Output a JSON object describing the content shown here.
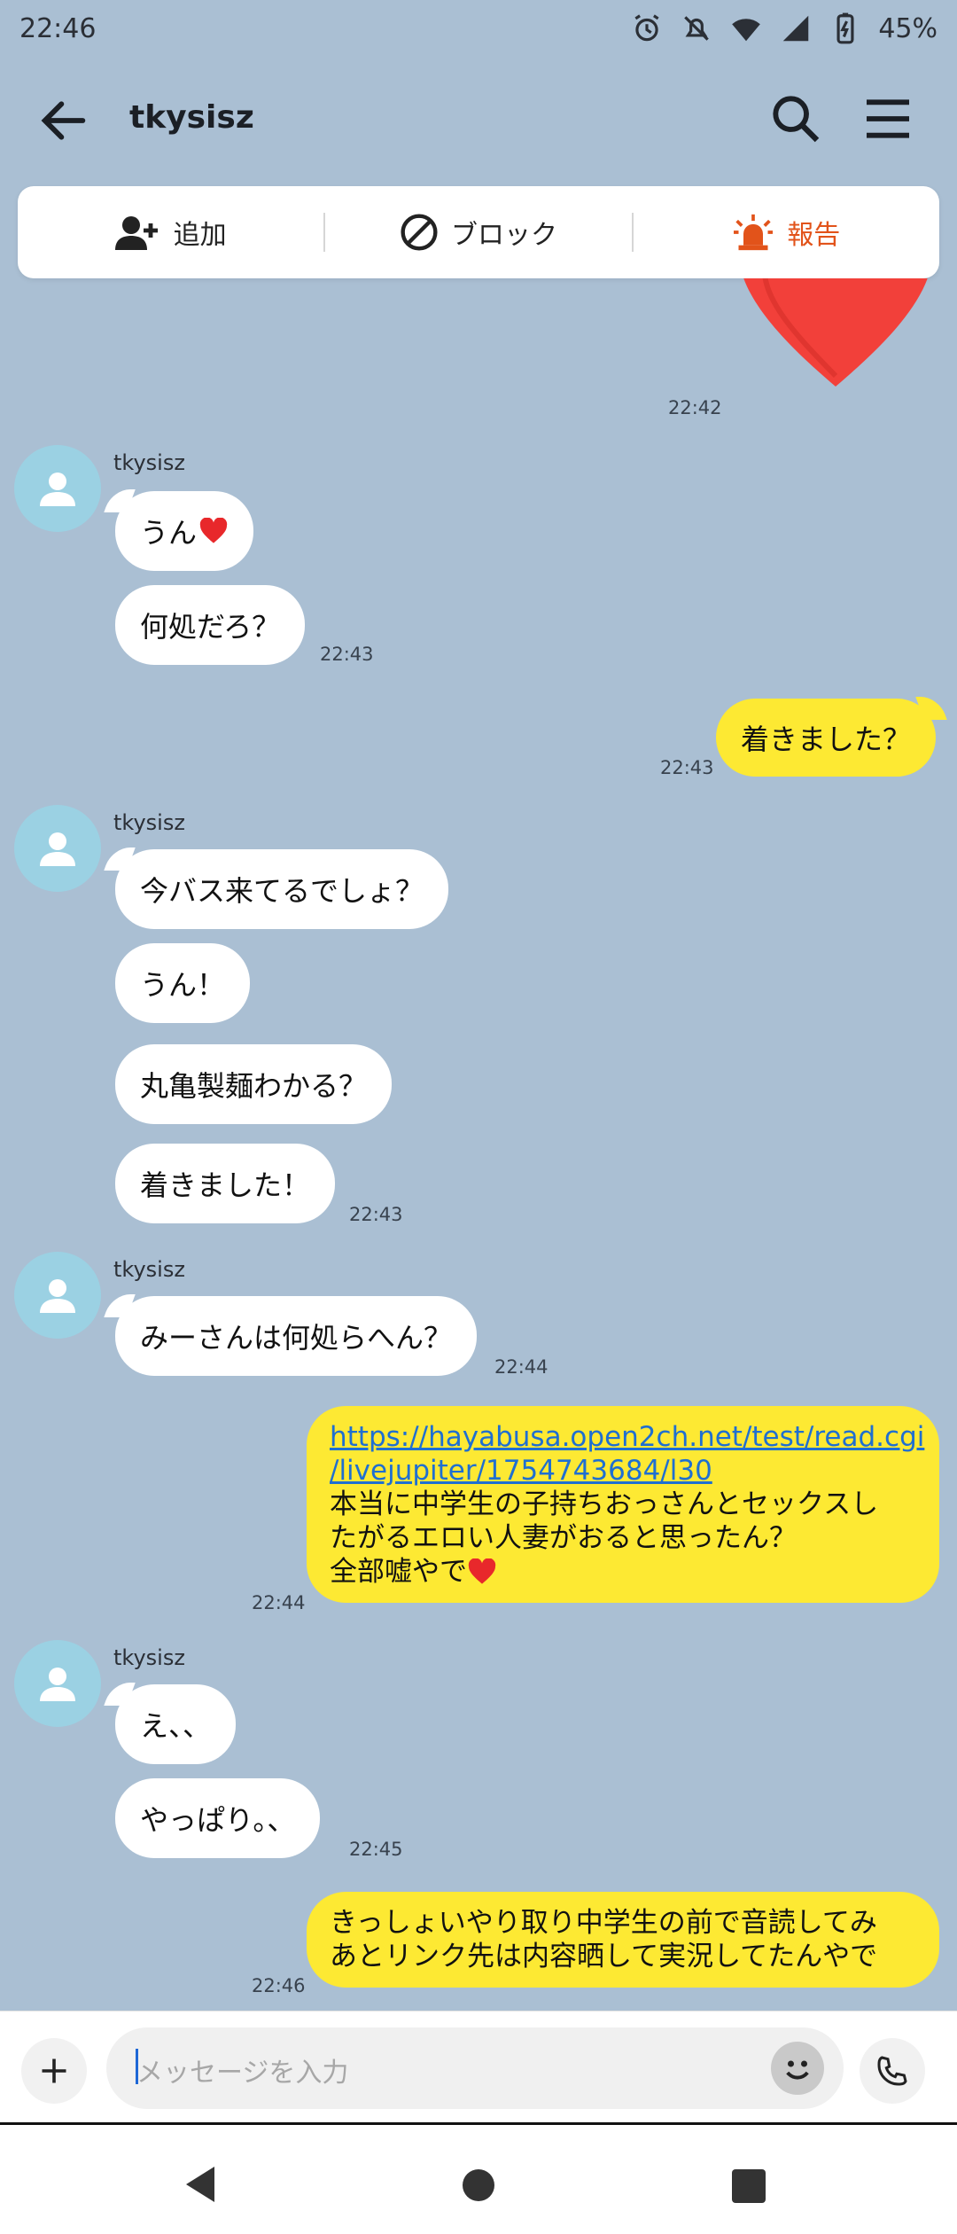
{
  "status": {
    "time": "22:46",
    "battery": "45%"
  },
  "header": {
    "title": "tkysisz"
  },
  "actions": {
    "add": "追加",
    "block": "ブロック",
    "report": "報告"
  },
  "chat": {
    "t0": "22:42",
    "s1_name": "tkysisz",
    "m1": "うん",
    "m2": "何処だろ？",
    "t1": "22:43",
    "my1": "着きました？",
    "t2": "22:43",
    "s2_name": "tkysisz",
    "m3": "今バス来てるでしょ？",
    "m4": "うん！",
    "m5": "丸亀製麺わかる？",
    "m6": "着きました！",
    "t3": "22:43",
    "s3_name": "tkysisz",
    "m7": "みーさんは何処らへん？",
    "t4": "22:44",
    "my2_link1": "https://hayabusa.open2ch.net/test/read.cgi",
    "my2_link2": "/livejupiter/1754743684/l30",
    "my2_line1": "本当に中学生の子持ちおっさんとセックスし",
    "my2_line2": "たがるエロい人妻がおると思ったん？",
    "my2_line3": "全部嘘やで",
    "t5": "22:44",
    "s4_name": "tkysisz",
    "m8": "え、、",
    "m9": "やっぱり。、",
    "t6": "22:45",
    "my3_line1": "きっしょいやり取り中学生の前で音読してみ",
    "my3_line2": "あとリンク先は内容晒して実況してたんやで",
    "t7": "22:46"
  },
  "input": {
    "placeholder": "メッセージを入力"
  },
  "colors": {
    "background": "#aabfd3",
    "my_bubble": "#fde933",
    "report": "#e2531a"
  },
  "icons": [
    "back-arrow-icon",
    "search-icon",
    "menu-icon",
    "add-friend-icon",
    "block-icon",
    "report-siren-icon",
    "heart-icon",
    "avatar-icon",
    "plus-icon",
    "emoji-icon",
    "phone-icon"
  ]
}
